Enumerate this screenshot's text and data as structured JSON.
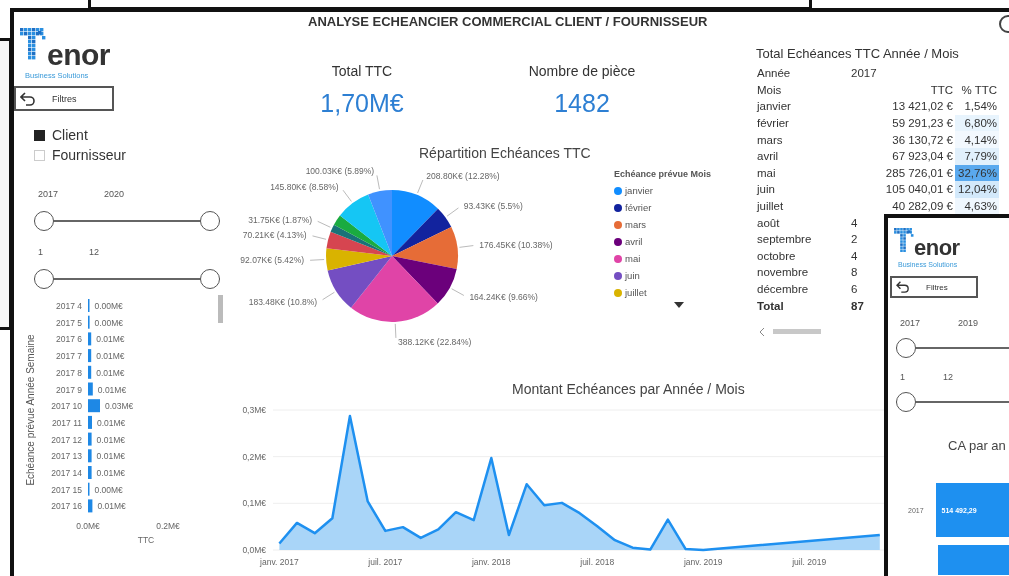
{
  "main_window": {
    "title": "ANALYSE ECHEANCIER COMMERCIAL CLIENT / FOURNISSEUR",
    "logo": {
      "wordmark": "enor",
      "tagline": "Business Solutions"
    },
    "reset_button": {
      "label": "Filtres"
    },
    "type_filter": [
      {
        "label": "Client",
        "checked": true
      },
      {
        "label": "Fournisseur",
        "checked": false
      }
    ],
    "sliders": [
      {
        "labels": [
          "2017",
          "2020"
        ],
        "thumbs": [
          {
            "level": 0
          },
          {
            "level": 1
          }
        ]
      },
      {
        "labels": [
          "1",
          "12"
        ],
        "thumbs": [
          {
            "level": 0
          },
          {
            "level": 1
          }
        ]
      }
    ],
    "weekly_chart": {
      "chart_data": {
        "type": "bar",
        "orientation": "horizontal",
        "ylabel": "Echéance prévue Année Semaine",
        "xlabel": "TTC",
        "categories": [
          "2017 4",
          "2017 5",
          "2017 6",
          "2017 7",
          "2017 8",
          "2017 9",
          "2017 10",
          "2017 11",
          "2017 12",
          "2017 13",
          "2017 14",
          "2017 15",
          "2017 16"
        ],
        "values": [
          0.003,
          0.004,
          0.008,
          0.008,
          0.008,
          0.012,
          0.03,
          0.01,
          0.009,
          0.009,
          0.009,
          0.002,
          0.011
        ],
        "value_labels": [
          "0.00M€",
          "0.00M€",
          "0.01M€",
          "0.01M€",
          "0.01M€",
          "0.01M€",
          "0.03M€",
          "0.01M€",
          "0.01M€",
          "0.01M€",
          "0.01M€",
          "0.00M€",
          "0.01M€"
        ],
        "xticks": [
          {
            "value": 0,
            "label": "0.0M€"
          },
          {
            "value": 0.2,
            "label": "0.2M€"
          }
        ],
        "xlim": [
          0,
          0.2
        ]
      }
    },
    "kpis": [
      {
        "label": "Total TTC",
        "value": "1,70M€"
      },
      {
        "label": "Nombre de pièce",
        "value": "1482"
      }
    ],
    "pie": {
      "chart_data": {
        "type": "pie",
        "title": "Répartition Echéances TTC",
        "values": [
          12.28,
          5.5,
          10.38,
          9.66,
          22.84,
          10.8,
          5.42,
          4.13,
          1.87,
          2.65,
          8.58,
          5.89
        ],
        "colors": [
          "#118dff",
          "#12239e",
          "#e66c37",
          "#6b007b",
          "#e044a7",
          "#744ec2",
          "#d9b300",
          "#d64550",
          "#197278",
          "#1aab40",
          "#15c6f4",
          "#4092ff"
        ],
        "value_labels": [
          "208.80K€ (12.28%)",
          "93.43K€ (5.5%)",
          "176.45K€ (10.38%)",
          "164.24K€ (9.66%)",
          "388.12K€ (22.84%)",
          "183.48K€ (10.8%)",
          "92.07K€ (5.42%)",
          "70.21K€ (4.13%)",
          "31.75K€ (1.87%)",
          null,
          "145.80K€ (8.58%)",
          "100.03K€ (5.89%)"
        ]
      },
      "legend": {
        "title": "Echéance prévue Mois",
        "items": [
          {
            "label": "janvier",
            "color": "#118dff"
          },
          {
            "label": "février",
            "color": "#12239e"
          },
          {
            "label": "mars",
            "color": "#e66c37"
          },
          {
            "label": "avril",
            "color": "#6b007b"
          },
          {
            "label": "mai",
            "color": "#e044a7"
          },
          {
            "label": "juin",
            "color": "#744ec2"
          },
          {
            "label": "juillet",
            "color": "#d9b300"
          }
        ]
      }
    },
    "matrix": {
      "title": "Total Echéances TTC Année / Mois",
      "year_label": "Année",
      "year": "2017",
      "columns": [
        "Mois",
        "TTC",
        "% TTC"
      ],
      "rows": [
        {
          "month": "janvier",
          "ttc": "13 421,02 €",
          "pct": "1,54%",
          "color": "#ffffff"
        },
        {
          "month": "février",
          "ttc": "59 291,23 €",
          "pct": "6,80%",
          "color": "#e8f4fd"
        },
        {
          "month": "mars",
          "ttc": "36 130,72 €",
          "pct": "4,14%",
          "color": "#f2f8fe"
        },
        {
          "month": "avril",
          "ttc": "67 923,04 €",
          "pct": "7,79%",
          "color": "#e1f0fc"
        },
        {
          "month": "mai",
          "ttc": "285 726,01 €",
          "pct": "32,76%",
          "color": "#5aa9ee"
        },
        {
          "month": "juin",
          "ttc": "105 040,01 €",
          "pct": "12,04%",
          "color": "#d3e9fb"
        },
        {
          "month": "juillet",
          "ttc": "40 282,09 €",
          "pct": "4,63%",
          "color": "#eff7fe"
        },
        {
          "month": "août",
          "ttc": "4"
        },
        {
          "month": "septembre",
          "ttc": "2"
        },
        {
          "month": "octobre",
          "ttc": "4"
        },
        {
          "month": "novembre",
          "ttc": "8"
        },
        {
          "month": "décembre",
          "ttc": "6"
        }
      ],
      "total": {
        "label": "Total",
        "ttc": "87"
      }
    },
    "line_chart": {
      "chart_data": {
        "type": "area",
        "title": "Montant Echéances par Année / Mois",
        "x": [
          2017,
          2017.083,
          2017.167,
          2017.25,
          2017.333,
          2017.417,
          2017.5,
          2017.583,
          2017.667,
          2017.75,
          2017.833,
          2017.917,
          2018,
          2018.083,
          2018.167,
          2018.25,
          2018.333,
          2018.417,
          2018.5,
          2018.583,
          2018.667,
          2018.75,
          2018.833,
          2018.917,
          2019,
          2019.833
        ],
        "values": [
          0.014,
          0.058,
          0.036,
          0.068,
          0.287,
          0.104,
          0.041,
          0.049,
          0.026,
          0.044,
          0.081,
          0.064,
          0.197,
          0.032,
          0.141,
          0.096,
          0.101,
          0.079,
          0.051,
          0.021,
          0.005,
          0.001,
          0.065,
          0.002,
          0.0,
          0.032
        ],
        "xticks": [
          {
            "value": 2017,
            "label": "janv. 2017"
          },
          {
            "value": 2017.5,
            "label": "juil. 2017"
          },
          {
            "value": 2018,
            "label": "janv. 2018"
          },
          {
            "value": 2018.5,
            "label": "juil. 2018"
          },
          {
            "value": 2019,
            "label": "janv. 2019"
          },
          {
            "value": 2019.5,
            "label": "juil. 2019"
          }
        ],
        "yticks": [
          {
            "value": 0,
            "label": "0,0M€"
          },
          {
            "value": 0.1,
            "label": "0,1M€"
          },
          {
            "value": 0.2,
            "label": "0,2M€"
          },
          {
            "value": 0.3,
            "label": "0,3M€"
          }
        ],
        "xlim": [
          2016.97,
          2019.9
        ],
        "ylim": [
          0,
          0.3
        ]
      }
    }
  },
  "overlay_window": {
    "logo": {
      "wordmark": "enor",
      "tagline": "Business Solutions"
    },
    "reset_button": {
      "label": "Filtres"
    },
    "sliders": [
      {
        "labels": [
          "2017",
          "2019"
        ],
        "thumbs": [
          {
            "level": 0
          }
        ]
      },
      {
        "labels": [
          "1",
          "12"
        ],
        "thumbs": [
          {
            "level": 0
          }
        ]
      }
    ],
    "chart": {
      "title": "CA par an",
      "rows": [
        {
          "label": "2017",
          "value": "514 492,29"
        }
      ]
    }
  }
}
